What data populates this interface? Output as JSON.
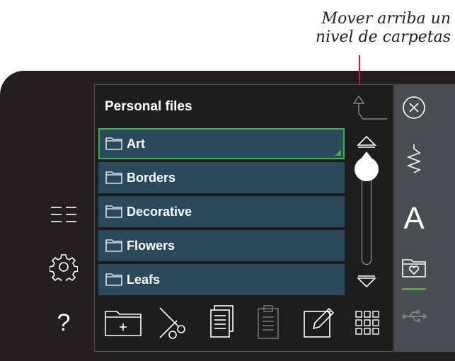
{
  "annotation": {
    "line1": "Mover arriba un",
    "line2": "nivel de carpetas"
  },
  "panel": {
    "title": "Personal files",
    "folders": [
      {
        "label": "Art",
        "selected": true
      },
      {
        "label": "Borders",
        "selected": false
      },
      {
        "label": "Decorative",
        "selected": false
      },
      {
        "label": "Flowers",
        "selected": false
      },
      {
        "label": "Leafs",
        "selected": false
      }
    ]
  },
  "left_rail": {
    "list_icon": "list-icon",
    "settings_icon": "gear-icon",
    "help_label": "?"
  },
  "right_rail": {
    "close_icon": "close-icon",
    "stitch_icon": "stitch-icon",
    "font_label": "A",
    "personal_folder_icon": "heart-folder-icon",
    "usb_icon": "usb-icon"
  },
  "colors": {
    "selection_border": "#3eb04b",
    "folder_row": "#2a4a5c",
    "annotation_line": "#d4143a"
  }
}
